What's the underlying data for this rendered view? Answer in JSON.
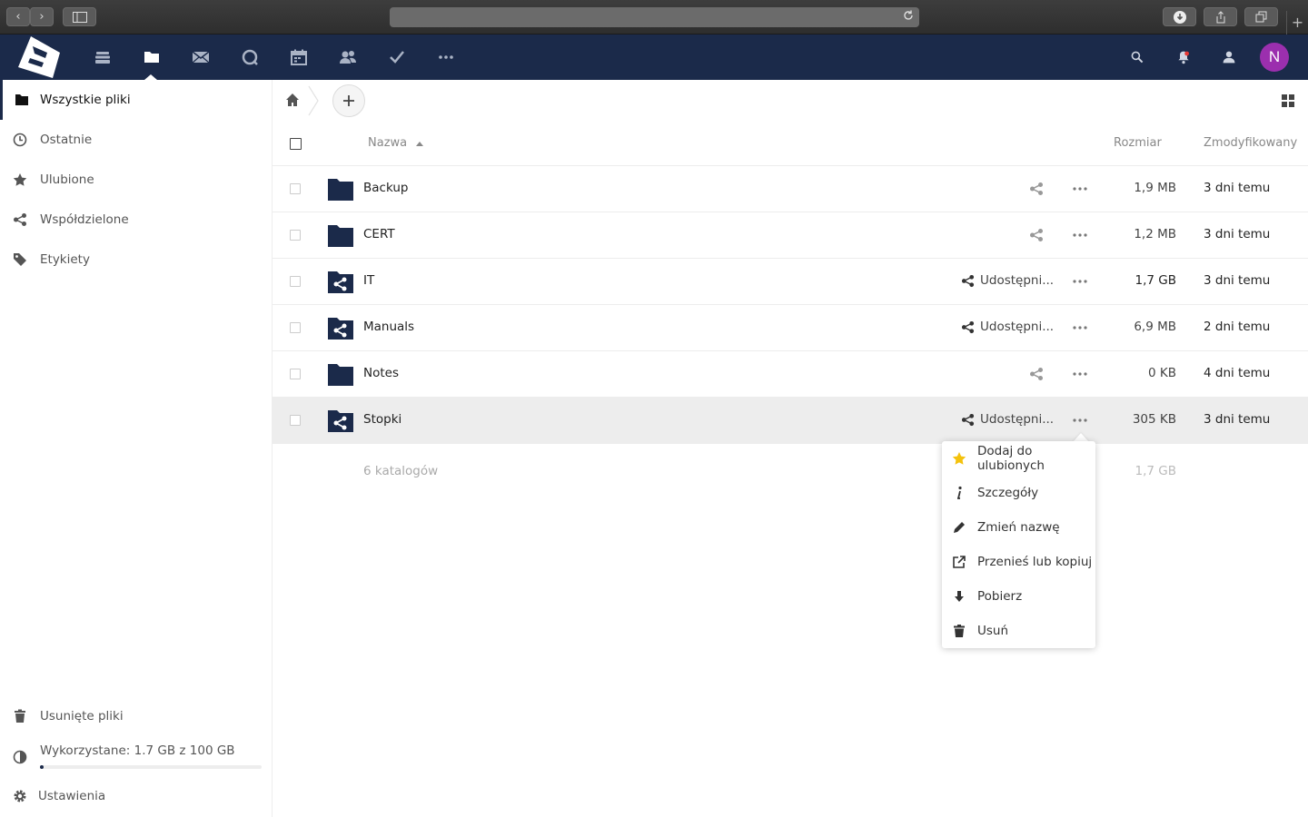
{
  "browser": {
    "back": "‹",
    "forward": "›",
    "new_tab": "+"
  },
  "user": {
    "avatar_initial": "N",
    "avatar_color": "#9b2fae"
  },
  "colors": {
    "header_bg": "#1b2a4a",
    "accent": "#1b2a4a",
    "star": "#f4c20d"
  },
  "sidebar": {
    "items": [
      {
        "label": "Wszystkie pliki",
        "icon": "folder-icon"
      },
      {
        "label": "Ostatnie",
        "icon": "clock-icon"
      },
      {
        "label": "Ulubione",
        "icon": "star-icon"
      },
      {
        "label": "Współdzielone",
        "icon": "share-icon"
      },
      {
        "label": "Etykiety",
        "icon": "tag-icon"
      }
    ],
    "deleted": "Usunięte pliki",
    "quota_text": "Wykorzystane: 1.7 GB z 100 GB",
    "quota_fraction": 0.017,
    "settings": "Ustawienia"
  },
  "table": {
    "header": {
      "name": "Nazwa",
      "size": "Rozmiar",
      "modified": "Zmodyfikowany"
    },
    "rows": [
      {
        "name": "Backup",
        "shared": false,
        "share_label": "",
        "size": "1,9 MB",
        "modified": "3 dni temu"
      },
      {
        "name": "CERT",
        "shared": false,
        "share_label": "",
        "size": "1,2 MB",
        "modified": "3 dni temu"
      },
      {
        "name": "IT",
        "shared": true,
        "share_label": "Udostępni...",
        "size": "1,7 GB",
        "modified": "3 dni temu"
      },
      {
        "name": "Manuals",
        "shared": true,
        "share_label": "Udostępni...",
        "size": "6,9 MB",
        "modified": "2 dni temu"
      },
      {
        "name": "Notes",
        "shared": false,
        "share_label": "",
        "size": "0 KB",
        "modified": "4 dni temu"
      },
      {
        "name": "Stopki",
        "shared": true,
        "share_label": "Udostępni...",
        "size": "305 KB",
        "modified": "3 dni temu"
      }
    ],
    "summary": {
      "count": "6 katalogów",
      "size": "1,7 GB"
    }
  },
  "context_menu": {
    "items": [
      {
        "label": "Dodaj do ulubionych",
        "icon": "star-icon"
      },
      {
        "label": "Szczegóły",
        "icon": "info-icon"
      },
      {
        "label": "Zmień nazwę",
        "icon": "pencil-icon"
      },
      {
        "label": "Przenieś lub kopiuj",
        "icon": "external-link-icon"
      },
      {
        "label": "Pobierz",
        "icon": "download-icon"
      },
      {
        "label": "Usuń",
        "icon": "trash-icon"
      }
    ]
  }
}
